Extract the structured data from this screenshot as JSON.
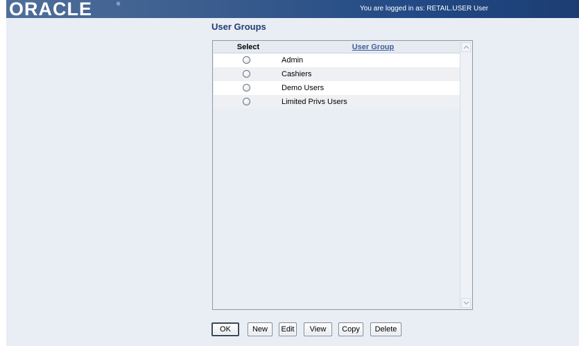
{
  "header": {
    "logo_text": "ORACLE",
    "logo_mark": "®",
    "login_text": "You are logged in as: RETAIL.USER User"
  },
  "page": {
    "title": "User Groups"
  },
  "table": {
    "columns": {
      "select": "Select",
      "user_group": "User Group"
    },
    "rows": [
      {
        "label": "Admin"
      },
      {
        "label": "Cashiers"
      },
      {
        "label": "Demo Users"
      },
      {
        "label": "Limited Privs Users"
      }
    ]
  },
  "buttons": {
    "ok": "OK",
    "new": "New",
    "edit": "Edit",
    "view": "View",
    "copy": "Copy",
    "delete": "Delete"
  },
  "icons": {
    "scroll_up": "chevron-up-icon",
    "scroll_down": "chevron-down-icon"
  },
  "colors": {
    "header_gradient_start": "#4f6f9a",
    "header_gradient_end": "#1c3d73",
    "panel_background": "#e9edf4",
    "title_color": "#1f3d6e",
    "link_color": "#3c5d9a"
  }
}
